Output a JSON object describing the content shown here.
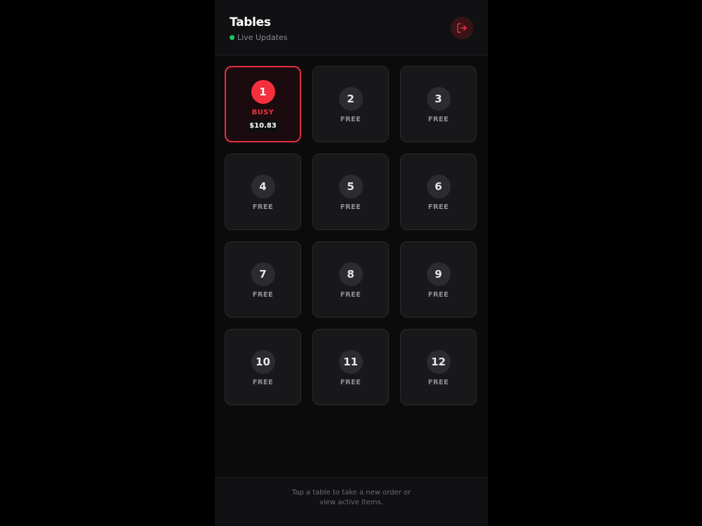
{
  "header": {
    "title": "Tables",
    "live_label": "Live Updates",
    "live_color": "#22c55e",
    "logout_icon": "logout-icon",
    "logout_color": "#e8323f"
  },
  "tables": [
    {
      "number": "1",
      "status": "BUSY",
      "amount": "$10.83"
    },
    {
      "number": "2",
      "status": "FREE"
    },
    {
      "number": "3",
      "status": "FREE"
    },
    {
      "number": "4",
      "status": "FREE"
    },
    {
      "number": "5",
      "status": "FREE"
    },
    {
      "number": "6",
      "status": "FREE"
    },
    {
      "number": "7",
      "status": "FREE"
    },
    {
      "number": "8",
      "status": "FREE"
    },
    {
      "number": "9",
      "status": "FREE"
    },
    {
      "number": "10",
      "status": "FREE"
    },
    {
      "number": "11",
      "status": "FREE"
    },
    {
      "number": "12",
      "status": "FREE"
    }
  ],
  "footer": {
    "hint": "Tap a table to take a new order or view active items."
  },
  "colors": {
    "busy_accent": "#f4303f",
    "background": "#0b0b0c"
  }
}
